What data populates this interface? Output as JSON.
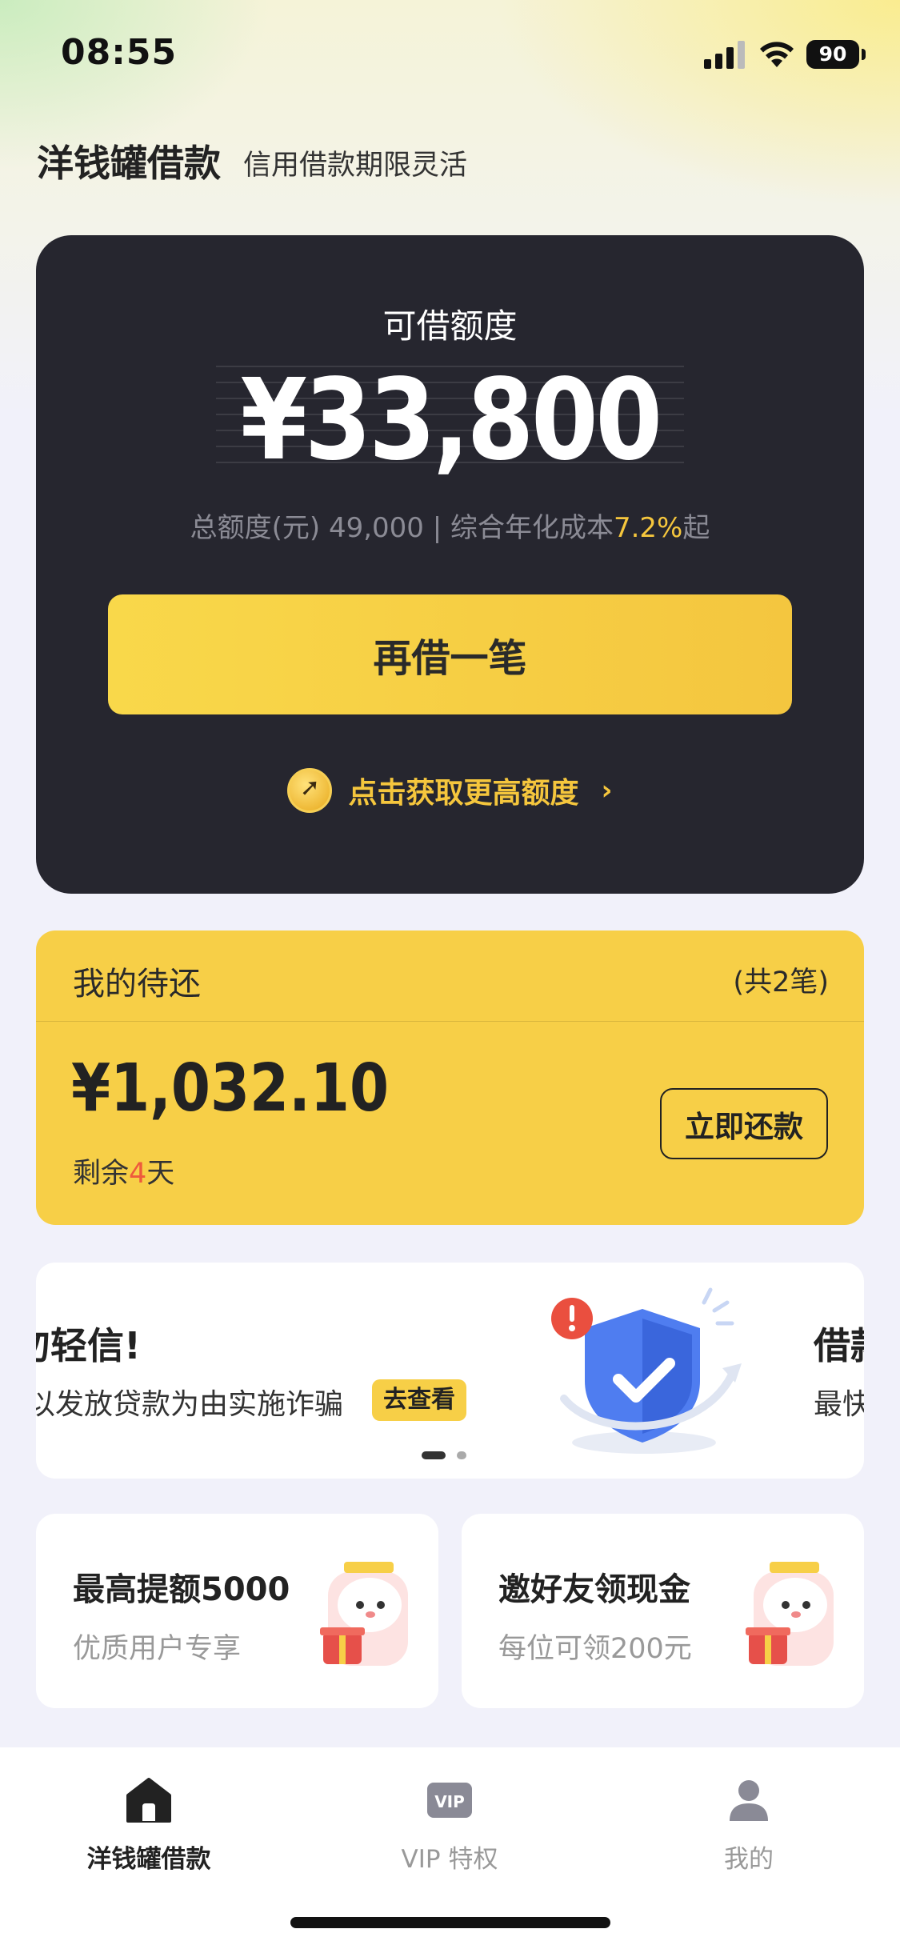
{
  "status_bar": {
    "time": "08:55",
    "battery": "90"
  },
  "header": {
    "title": "洋钱罐借款",
    "subtitle": "信用借款期限灵活"
  },
  "credit_card": {
    "label": "可借额度",
    "amount": "¥33,800",
    "info_prefix": "总额度(元) 49,000 | 综合年化成本",
    "rate": "7.2%",
    "info_suffix": "起",
    "borrow_button": "再借一笔",
    "raise_link": "点击获取更高额度",
    "raise_chevron": "›",
    "accent_color": "#f5c63d"
  },
  "repayment": {
    "title": "我的待还",
    "count": "(共2笔)",
    "amount": "¥1,032.10",
    "days_prefix": "剩余",
    "days_value": "4",
    "days_suffix": "天",
    "button": "立即还款"
  },
  "banner": {
    "title": "勿轻信!",
    "desc": "以发放贷款为由实施诈骗",
    "badge": "去查看",
    "next_title": "借款",
    "next_desc": "最快",
    "icon": "security-shield-icon",
    "page_current": 1,
    "page_total": 2
  },
  "promos": [
    {
      "title": "最高提额5000",
      "subtitle": "优质用户专享",
      "icon": "mascot-gift-icon"
    },
    {
      "title": "邀好友领现金",
      "subtitle": "每位可领200元",
      "icon": "mascot-gift-icon"
    }
  ],
  "tabbar": {
    "items": [
      {
        "label": "洋钱罐借款",
        "icon": "home-icon",
        "active": true
      },
      {
        "label": "VIP 特权",
        "icon": "vip-icon",
        "active": false
      },
      {
        "label": "我的",
        "icon": "user-icon",
        "active": false
      }
    ]
  }
}
